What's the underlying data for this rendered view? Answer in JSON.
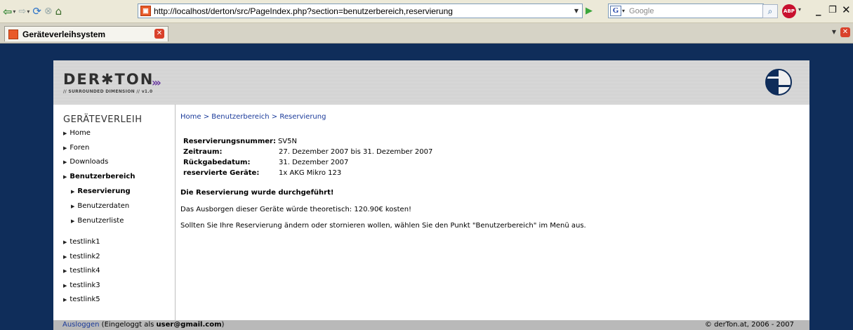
{
  "browser": {
    "url": "http://localhost/derton/src/PageIndex.php?section=benutzerbereich,reservierung",
    "search_placeholder": "Google",
    "tab_title": "Geräteverleihsystem"
  },
  "site": {
    "logo_text": "DER✱TON",
    "logo_sub": "// SURROUNDED DIMENSION // v1.0",
    "logo_arrows": "›››"
  },
  "sidebar": {
    "title": "GERÄTEVERLEIH",
    "items": [
      {
        "label": "Home"
      },
      {
        "label": "Foren"
      },
      {
        "label": "Downloads"
      },
      {
        "label": "Benutzerbereich"
      },
      {
        "label": "Reservierung"
      },
      {
        "label": "Benutzerdaten"
      },
      {
        "label": "Benutzerliste"
      },
      {
        "label": "testlink1"
      },
      {
        "label": "testlink2"
      },
      {
        "label": "testlink4"
      },
      {
        "label": "testlink3"
      },
      {
        "label": "testlink5"
      }
    ]
  },
  "breadcrumb": {
    "home": "Home",
    "sep": ">",
    "section": "Benutzerbereich",
    "current": "Reservierung"
  },
  "reservation": {
    "number_label": "Reservierungsnummer:",
    "number_value": "SV5N",
    "period_label": "Zeitraum:",
    "period_value": "27. Dezember 2007 bis 31. Dezember 2007",
    "return_label": "Rückgabedatum:",
    "return_value": "31. Dezember 2007",
    "devices_label": "reservierte Geräte:",
    "devices_value": "1x AKG Mikro 123"
  },
  "messages": {
    "success": "Die Reservierung wurde durchgeführt!",
    "cost": "Das Ausborgen dieser Geräte würde theoretisch: 120.90€ kosten!",
    "hint": "Sollten Sie Ihre Reservierung ändern oder stornieren wollen, wählen Sie den Punkt \"Benutzerbereich\" im Menü aus."
  },
  "footer": {
    "logout": "Ausloggen",
    "logged_in_prefix": " (Eingeloggt als ",
    "user": "user@gmail.com",
    "logged_in_suffix": ")",
    "copyright": "© derTon.at, 2006 - 2007"
  }
}
